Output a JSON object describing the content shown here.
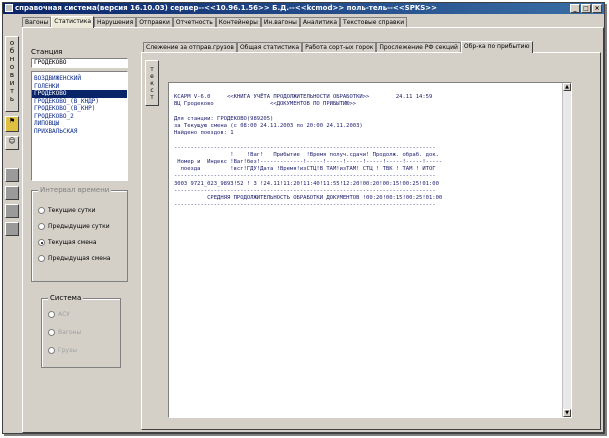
{
  "window": {
    "title": "справочная система(версия 16.10.03) сервер--<<10.96.1.56>> Б.Д.--<<kcmod>> поль-тель--<<SPKS>>",
    "controls": [
      "_",
      "□",
      "×"
    ]
  },
  "left_toolbar": {
    "update_button": "обновить"
  },
  "main_tabs": [
    {
      "label": "Вагоны"
    },
    {
      "label": "Статистика"
    },
    {
      "label": "Нарушения"
    },
    {
      "label": "Отправки"
    },
    {
      "label": "Отчетность"
    },
    {
      "label": "Контейнеры"
    },
    {
      "label": "Ин.вагоны"
    },
    {
      "label": "Аналитика"
    },
    {
      "label": "Текстовые справки"
    }
  ],
  "main_tabs_active": "Статистика",
  "station": {
    "label": "Станция",
    "value": "ГРОДЕКОВО",
    "items": [
      {
        "label": "ВОЗДВИЖЕНСКИЙ"
      },
      {
        "label": "ГОЛЕНКИ"
      },
      {
        "label": "ГРОДЕКОВО"
      },
      {
        "label": "ГРОДЕКОВО_(В_КНДР)"
      },
      {
        "label": "ГРОДЕКОВО_(В_КНР)"
      },
      {
        "label": "ГРОДЕКОВО_2"
      },
      {
        "label": "ЛИПОВЦЫ"
      },
      {
        "label": "ПРИХВАЛЬСКАЯ"
      }
    ],
    "selected": "ГРОДЕКОВО"
  },
  "period_group": {
    "title": "Интервал времени",
    "options": [
      {
        "label": "Текущие сутки"
      },
      {
        "label": "Предыдущие сутки"
      },
      {
        "label": "Текущая смена"
      },
      {
        "label": "Предыдущая смена"
      }
    ],
    "selected": "Текущая смена"
  },
  "system_group": {
    "title": "Система",
    "options": [
      {
        "label": "АСУ"
      },
      {
        "label": "Вагоны"
      },
      {
        "label": "Грузы"
      }
    ]
  },
  "sub_tabs": [
    {
      "label": "Слежение за отправ.грузов"
    },
    {
      "label": "Общая статистика"
    },
    {
      "label": "Работа сорт-ых горок"
    },
    {
      "label": "Прослежение РФ секций"
    },
    {
      "label": "Обр-ка по прибытию"
    }
  ],
  "sub_tabs_active": "Обр-ка по прибытию",
  "text_button": "текст",
  "report": {
    "lines": [
      "",
      "КСАРМ V-6.0     <<КНИГА УЧЁТА ПРОДОЛЖИТЕЛЬНОСТИ ОБРАБОТКИ>>        24.11 14:59",
      "ВЦ Гродеково                 <<ДОКУМЕНТОВ ПО ПРИБЫТИЮ>>",
      "",
      "Для станции: ГРОДЕКОВО(989205)",
      "за Текущую смена (с 08:00 24.11.2003 по 20:00 24.11.2003)",
      "Найдено поездов: 1",
      "",
      "-------------------------------------------------------------------------------",
      "                 !    !Ваг!   Прибытие  !Время получ.сдачи! Продолж. обраб. док.",
      " Номер и  Индекс !Ваг!без!-------------!-----!-----!-----!-----!-----!-----!-----",
      "  поезда         !всг!ГДУ!Дата !Время!изСТЦ!В ТАМ!изТАМ! СТЦ ! ТВК ! ТАМ ! ИТОГ",
      "-------------------------------------------------------------------------------",
      "3003 9721_023_9893!52 ! 3 !24.11!11:20!11:40!11:55!12:20!00:20!00:15!00:25!01:00",
      "-------------------------------------------------------------------------------",
      "          СРЕДНЯЯ ПРОДОЛЖИТЕЛЬНОСТЬ ОБРАБОТКИ ДОКУМЕНТОВ !00:20!00:15!00:25!01:00",
      "-------------------------------------------------------------------------------"
    ]
  }
}
